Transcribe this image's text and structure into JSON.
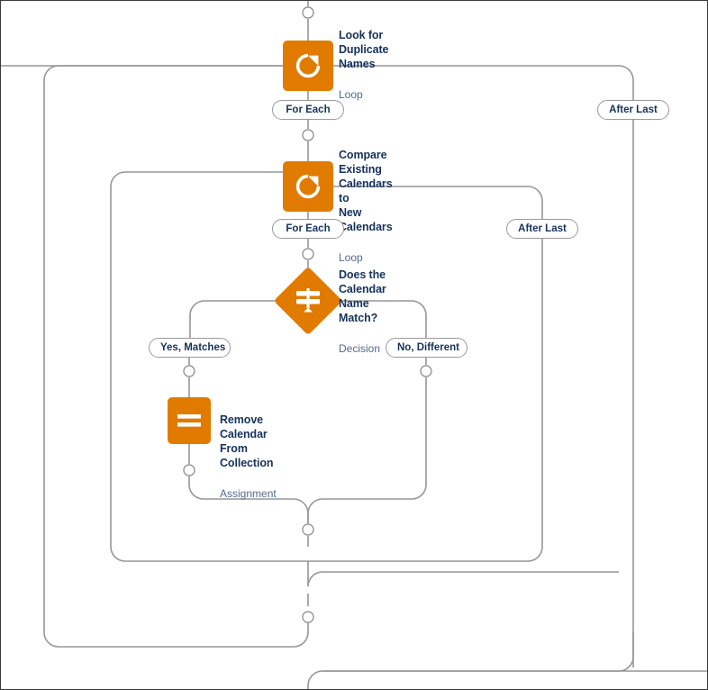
{
  "diagram": {
    "type": "flow-builder-canvas",
    "accent_color": "#e07b00",
    "connector_color": "#969696",
    "title_color": "#16325c",
    "subtitle_color": "#54698d",
    "nodes": [
      {
        "id": "look-for-duplicate-names",
        "title": "Look for Duplicate Names",
        "subtitle": "Loop",
        "icon": "loop-icon"
      },
      {
        "id": "compare-existing-calendars-to-new-calendars",
        "title": "Compare Existing Calendars to\nNew Calendars",
        "subtitle": "Loop",
        "icon": "loop-icon"
      },
      {
        "id": "does-the-calendar-name-match",
        "title": "Does the Calendar Name Match?",
        "subtitle": "Decision",
        "icon": "decision-icon"
      },
      {
        "id": "remove-calendar-from-collection",
        "title": "Remove Calendar From Collection",
        "subtitle": "Assignment",
        "icon": "assignment-icon"
      }
    ],
    "branch_labels": {
      "outer_loop_for_each": "For Each",
      "outer_loop_after_last": "After Last",
      "inner_loop_for_each": "For Each",
      "inner_loop_after_last": "After Last",
      "decision_yes": "Yes, Matches",
      "decision_no": "No, Different"
    }
  }
}
